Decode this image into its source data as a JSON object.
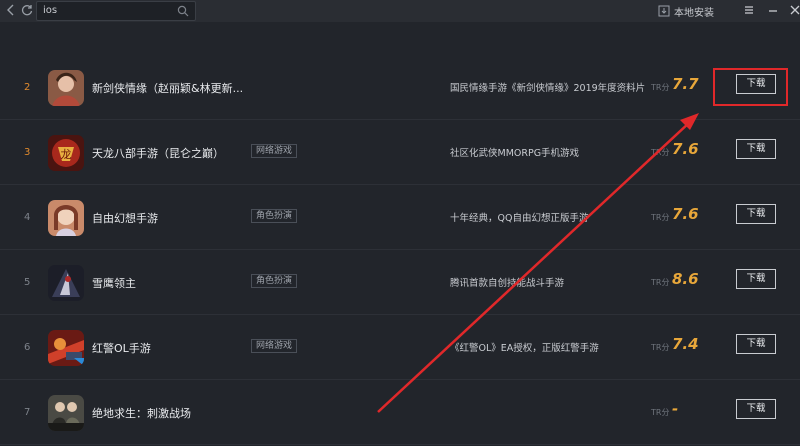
{
  "topbar": {
    "search_value": "ios",
    "local_install_label": "本地安装"
  },
  "rows": [
    {
      "rank": "2",
      "name": "新剑侠情缘（赵丽颖&林更新...",
      "category": "",
      "desc": "国民情缘手游《新剑侠情缘》2019年度资料片【...",
      "tr_label": "TR分",
      "score": "7.7",
      "download": "下载"
    },
    {
      "rank": "3",
      "name": "天龙八部手游（昆仑之巅）",
      "category": "网络游戏",
      "desc": "社区化武侠MMORPG手机游戏",
      "tr_label": "TR分",
      "score": "7.6",
      "download": "下载"
    },
    {
      "rank": "4",
      "name": "自由幻想手游",
      "category": "角色扮演",
      "desc": "十年经典，QQ自由幻想正版手游",
      "tr_label": "TR分",
      "score": "7.6",
      "download": "下载"
    },
    {
      "rank": "5",
      "name": "雪鹰领主",
      "category": "角色扮演",
      "desc": "腾讯首款自创持能战斗手游",
      "tr_label": "TR分",
      "score": "8.6",
      "download": "下载"
    },
    {
      "rank": "6",
      "name": "红警OL手游",
      "category": "网络游戏",
      "desc": "《红警OL》EA授权，正版红警手游",
      "tr_label": "TR分",
      "score": "7.4",
      "download": "下载"
    },
    {
      "rank": "7",
      "name": "绝地求生：刺激战场",
      "category": "",
      "desc": "",
      "tr_label": "TR分",
      "score": "-",
      "download": "下载"
    }
  ],
  "colors": {
    "background": "#22252b",
    "score": "#e8a73a",
    "highlight": "#e0282a"
  }
}
